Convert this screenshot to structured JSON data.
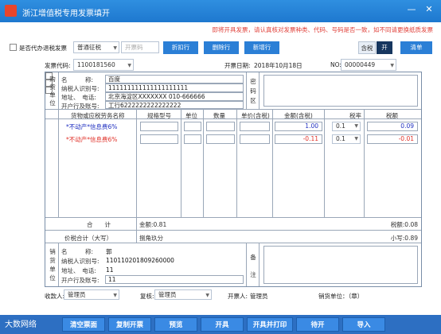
{
  "window": {
    "title": "浙江增值税专用发票填开",
    "min": "—",
    "close": "✕",
    "brand_color": "#1e78cf",
    "icon": "invoice-icon"
  },
  "notice": "即将开具发票，请认真核对发票种类、代码、号码是否一致，如不同请更换纸质发票",
  "toolbar": {
    "substitute_label": "是否代办退税发票",
    "tax_type": "普通征税",
    "invoice_code_placeholder": "开票码",
    "discount_row": "折扣行",
    "delete_row": "删除行",
    "add_row": "新增行",
    "tax_incl": "含税",
    "tax_toggle": "开",
    "clear": "清单"
  },
  "header": {
    "code_label": "发票代码:",
    "code_value": "1100181560",
    "date_label": "开票日期:",
    "date_value": "2018年10月18日",
    "no_label": "NO:",
    "no_value": "00000449"
  },
  "buyer": {
    "side_label": [
      "购",
      "货",
      "单",
      "位"
    ],
    "name_label": "名　　　称:",
    "name_value": "百度",
    "taxid_label": "纳税人识别号:",
    "taxid_value": "111111111111111111111",
    "addr_label": "地址、　电话:",
    "addr_value": "北京海淀区XXXXXXX 010-666666",
    "bank_label": "开户行及账号:",
    "bank_value": "工行6222222222222222",
    "cipher_label": [
      "密",
      "码",
      "区"
    ]
  },
  "items": {
    "headers": [
      "货物或应税劳务名称",
      "规格型号",
      "单位",
      "数量",
      "单价(含税)",
      "金额(含税)",
      "税率",
      "税额"
    ],
    "rows": [
      {
        "name": "*不动产*信息费6%",
        "amount": "1.00",
        "rate": "0.1",
        "tax": "0.09",
        "color": "blue"
      },
      {
        "name": "*不动产*信息费6%",
        "amount": "-0.11",
        "rate": "0.1",
        "tax": "-0.01",
        "color": "red"
      }
    ],
    "total_label": "合　　计",
    "total_amount": "金额:0.81",
    "total_tax": "税额:0.08",
    "grand_label": "价税合计（大写）",
    "grand_upper": "捌角玖分",
    "grand_lower": "小写:0.89"
  },
  "seller": {
    "side_label": [
      "销",
      "货",
      "单",
      "位"
    ],
    "name_label": "名　　　称:",
    "name_value": "郭",
    "taxid_label": "纳税人识别号:",
    "taxid_value": "110110201809260000",
    "addr_label": "地址、　电话:",
    "addr_value": "11",
    "bank_label": "开户行及账号:",
    "bank_value": "11",
    "remark_label": [
      "备",
      "注"
    ]
  },
  "signers": {
    "payee_label": "收款人:",
    "payee_value": "管理员",
    "reviewer_label": "复核:",
    "reviewer_value": "管理员",
    "drawer_label": "开票人:",
    "drawer_value": "管理员",
    "seller_seal": "销货单位：（章）"
  },
  "footer": {
    "logo": "大数网络",
    "buttons": [
      "清空票面",
      "复制开票",
      "预览",
      "开具",
      "开具并打印",
      "待开",
      "导入"
    ]
  }
}
